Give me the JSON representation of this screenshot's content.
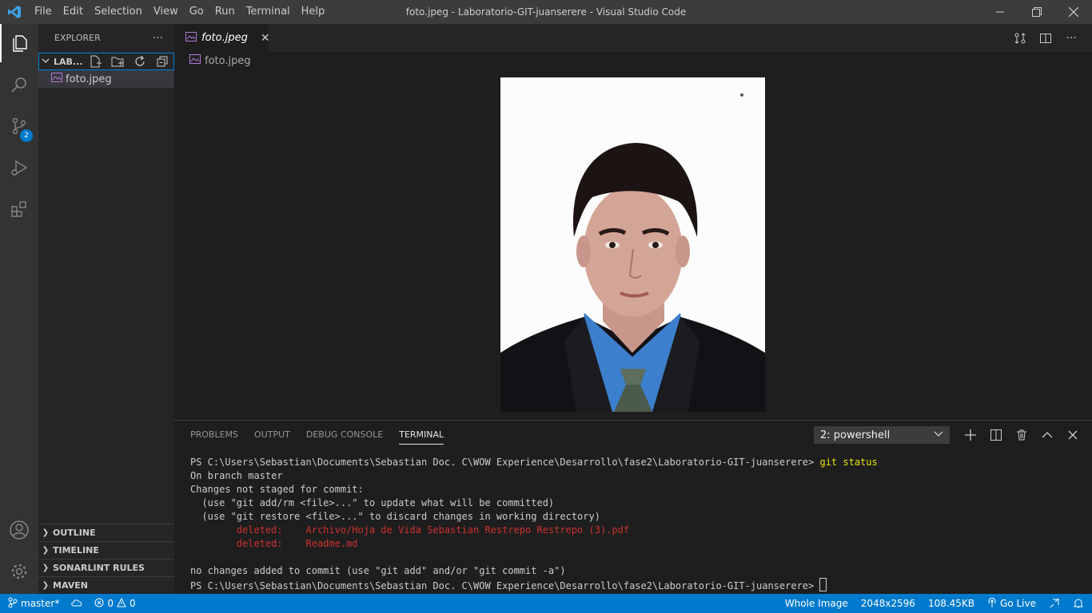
{
  "menu": [
    "File",
    "Edit",
    "Selection",
    "View",
    "Go",
    "Run",
    "Terminal",
    "Help"
  ],
  "window_title": "foto.jpeg - Laboratorio-GIT-juanserere - Visual Studio Code",
  "activity": {
    "scm_badge": "2"
  },
  "sidebar": {
    "title": "EXPLORER",
    "more": "···",
    "folder": "LAB...",
    "file": "foto.jpeg",
    "sections": [
      "OUTLINE",
      "TIMELINE",
      "SONARLINT RULES",
      "MAVEN"
    ]
  },
  "tab": {
    "label": "foto.jpeg",
    "close": "✕"
  },
  "breadcrumb": "foto.jpeg",
  "panel": {
    "tabs": [
      "PROBLEMS",
      "OUTPUT",
      "DEBUG CONSOLE",
      "TERMINAL"
    ],
    "active_tab": "TERMINAL",
    "terminal_select": "2: powershell"
  },
  "terminal": {
    "prompt": "PS C:\\Users\\Sebastian\\Documents\\Sebastian Doc. C\\WOW Experience\\Desarrollo\\fase2\\Laboratorio-GIT-juanserere> ",
    "command": "git status",
    "line1": "On branch master",
    "line2": "Changes not staged for commit:",
    "line3": "  (use \"git add/rm <file>...\" to update what will be committed)",
    "line4": "  (use \"git restore <file>...\" to discard changes in working directory)",
    "deleted1": "        deleted:    Archivo/Hoja de Vida Sebastian Restrepo Restrepo (3).pdf",
    "deleted2": "        deleted:    Readme.md",
    "line5": "no changes added to commit (use \"git add\" and/or \"git commit -a\")",
    "prompt2": "PS C:\\Users\\Sebastian\\Documents\\Sebastian Doc. C\\WOW Experience\\Desarrollo\\fase2\\Laboratorio-GIT-juanserere> "
  },
  "status": {
    "branch": "master*",
    "errors": "0",
    "warnings": "0",
    "image_mode": "Whole Image",
    "dimensions": "2048x2596",
    "size": "108.45KB",
    "golive": "Go Live"
  },
  "colors": {
    "accent": "#007acc",
    "titlebar": "#3c3c3c",
    "sidebar": "#252526",
    "editor": "#1e1e1e"
  }
}
